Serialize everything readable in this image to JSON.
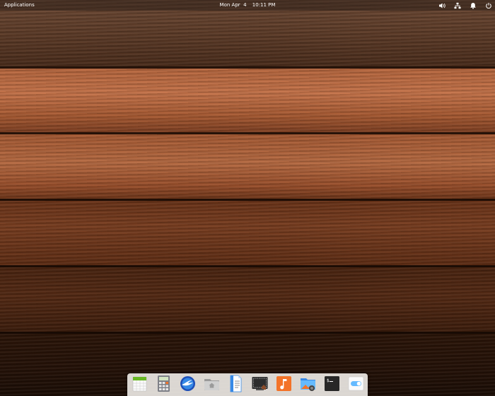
{
  "panel": {
    "applications_label": "Applications",
    "date": "Mon Apr  4",
    "time": "10:11 PM"
  },
  "indicators": [
    {
      "name": "volume-icon"
    },
    {
      "name": "network-icon"
    },
    {
      "name": "notifications-icon"
    },
    {
      "name": "power-icon"
    }
  ],
  "dock": {
    "apps": [
      {
        "name": "calendar-icon"
      },
      {
        "name": "calculator-icon"
      },
      {
        "name": "web-browser-icon"
      },
      {
        "name": "files-icon"
      },
      {
        "name": "text-editor-icon"
      },
      {
        "name": "screenshot-icon"
      },
      {
        "name": "music-icon"
      },
      {
        "name": "photos-icon"
      },
      {
        "name": "terminal-icon"
      },
      {
        "name": "settings-icon"
      }
    ]
  },
  "colors": {
    "dock_bg": "#ebe8e4",
    "panel_text": "#ffffff",
    "music_orange": "#f37329",
    "calendar_green": "#68b723",
    "browser_blue": "#3689e6"
  }
}
